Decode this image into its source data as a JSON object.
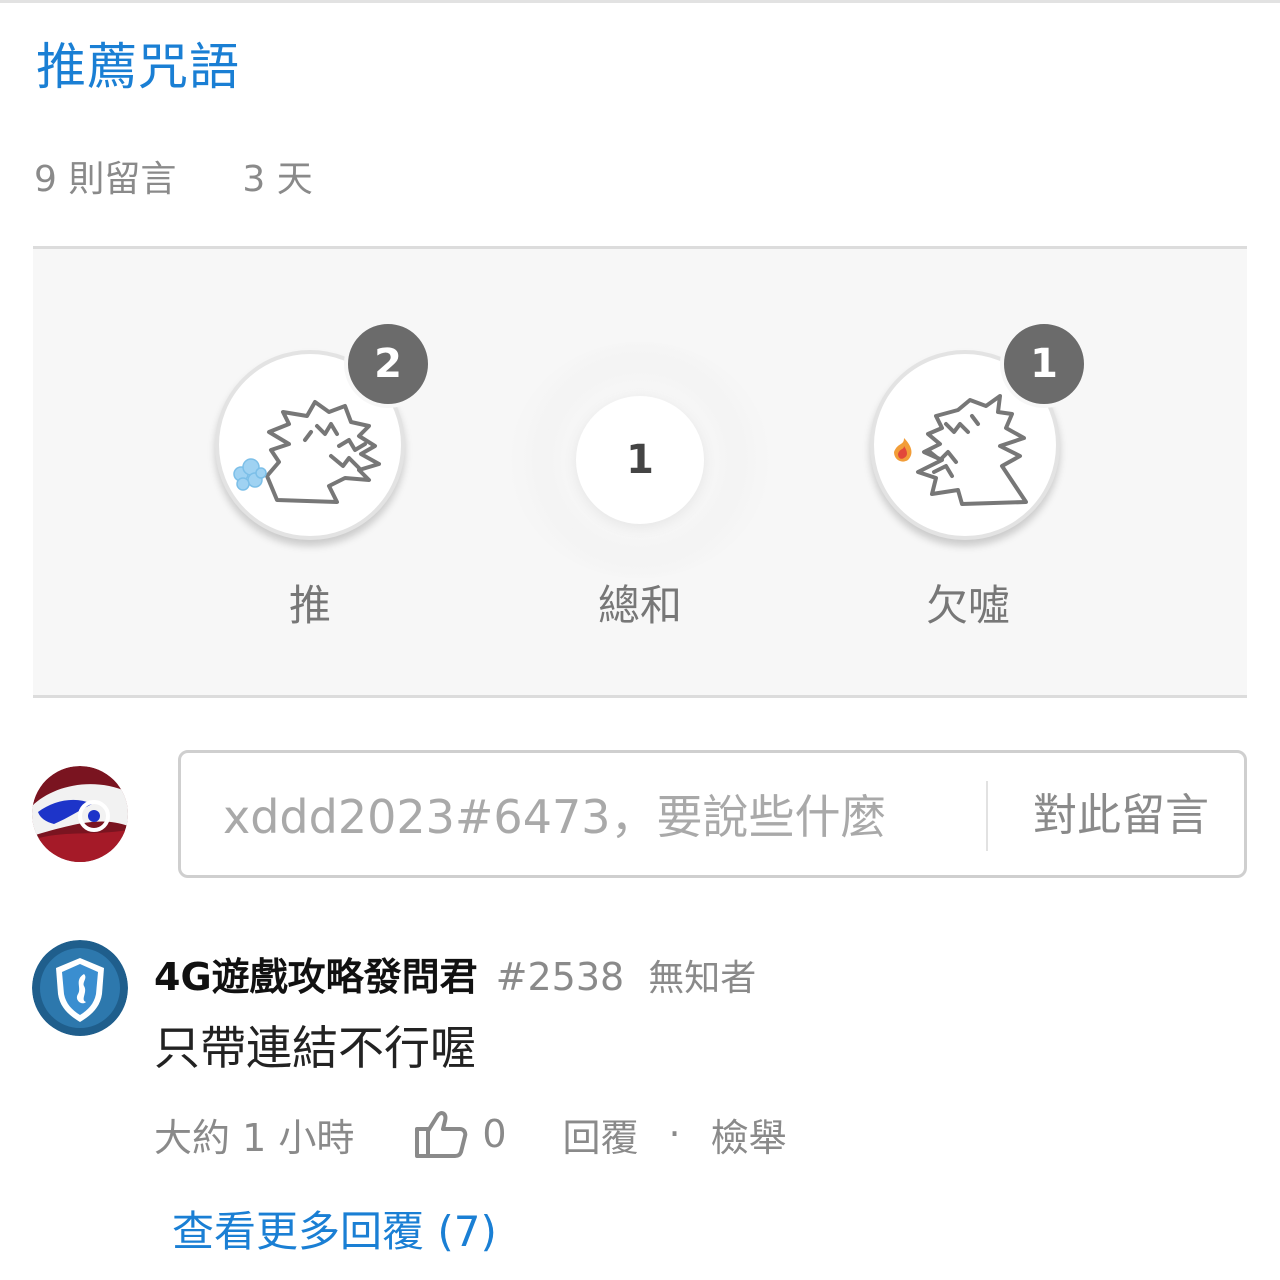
{
  "post": {
    "title": "推薦咒語",
    "comment_count": "9 則留言",
    "age": "3 天"
  },
  "reactions": {
    "push": {
      "label": "推",
      "count": "2",
      "icon": "dragon-blowing-air-icon"
    },
    "sum": {
      "label": "總和",
      "value": "1"
    },
    "boo": {
      "label": "欠噓",
      "count": "1",
      "icon": "dragon-breathing-fire-icon"
    }
  },
  "comment_form": {
    "placeholder": "xddd2023#6473，要說些什麼",
    "submit_label": "對此留言"
  },
  "reply": {
    "author": "4G遊戲攻略發問君",
    "author_id": "#2538",
    "rank": "無知者",
    "body": "只帶連結不行喔",
    "time": "大約 1 小時",
    "likes": "0",
    "reply_label": "回覆",
    "separator": "·",
    "report_label": "檢舉",
    "more_replies": "查看更多回覆 (7)"
  },
  "colors": {
    "accent": "#1a7fd4",
    "badge": "#6b6b6b",
    "panel_bg": "#f7f7f7"
  }
}
